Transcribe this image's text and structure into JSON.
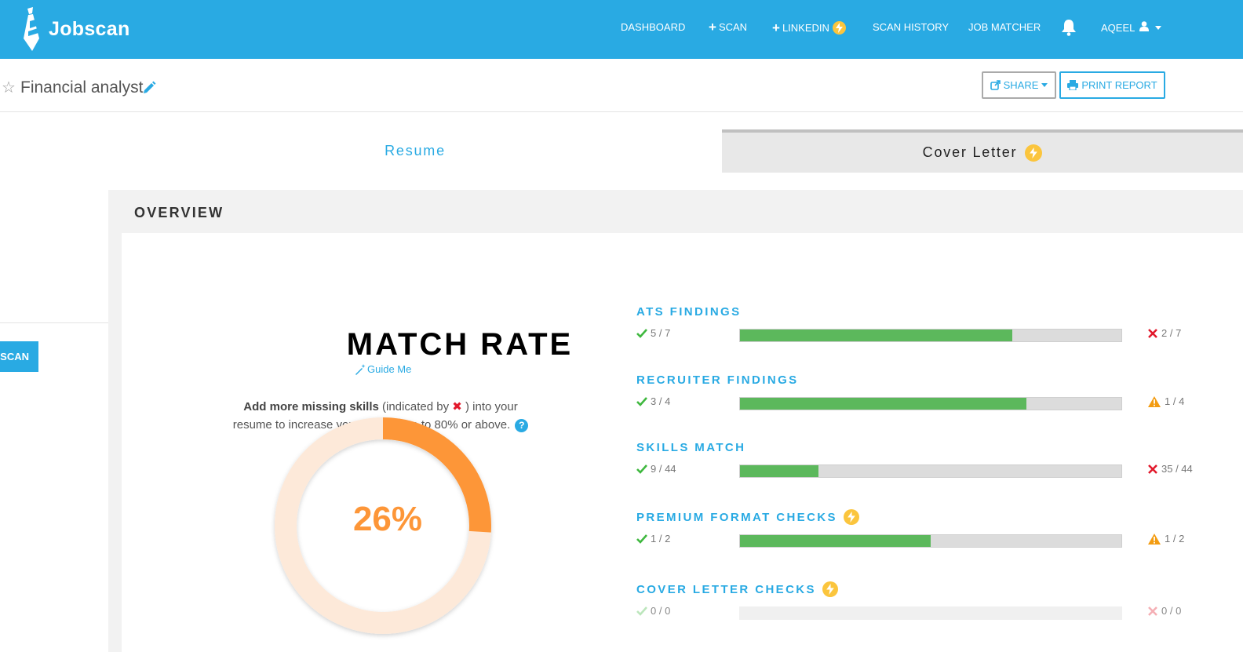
{
  "app": {
    "logo_text": "Jobscan",
    "colors": {
      "brand": "#29aae3",
      "accent_orange": "#fd9638",
      "success": "#5cb85c",
      "danger": "#e2192c",
      "warning": "#f39c12",
      "premium": "#fbc53d"
    }
  },
  "nav": {
    "dashboard": "DASHBOARD",
    "scan": "SCAN",
    "linkedin": "LINKEDIN",
    "scan_history": "SCAN HISTORY",
    "job_matcher": "JOB MATCHER",
    "user": "AQEEL"
  },
  "header": {
    "job_title": "Financial analyst",
    "share_label": "SHARE",
    "print_label": "PRINT REPORT"
  },
  "tabs": {
    "resume": "Resume",
    "cover_letter": "Cover Letter"
  },
  "sidebar": {
    "rescan_label": "ESCAN"
  },
  "overview": {
    "title": "OVERVIEW",
    "match_rate_title": "MATCH RATE",
    "guide_me": "Guide Me",
    "hint_bold": "Add more missing skills",
    "hint_paren_open": "(indicated by",
    "hint_paren_close": ") into your",
    "hint_line2": "resume to increase your match rate to 80% or above.",
    "match_rate_value": 0.26,
    "match_rate_label": "26%"
  },
  "findings": [
    {
      "title": "ATS FINDINGS",
      "passed": "5 / 7",
      "failed": "2 / 7",
      "fail_type": "error",
      "fill": 0.714,
      "premium": false
    },
    {
      "title": "RECRUITER FINDINGS",
      "passed": "3 / 4",
      "failed": "1 / 4",
      "fail_type": "warning",
      "fill": 0.75,
      "premium": false
    },
    {
      "title": "SKILLS MATCH",
      "passed": "9 / 44",
      "failed": "35 / 44",
      "fail_type": "error",
      "fill": 0.205,
      "premium": false
    },
    {
      "title": "PREMIUM FORMAT CHECKS",
      "passed": "1 / 2",
      "failed": "1 / 2",
      "fail_type": "warning",
      "fill": 0.5,
      "premium": true
    },
    {
      "title": "COVER LETTER CHECKS",
      "passed": "0 / 0",
      "failed": "0 / 0",
      "fail_type": "error-dim",
      "fill": 0,
      "premium": true
    }
  ]
}
